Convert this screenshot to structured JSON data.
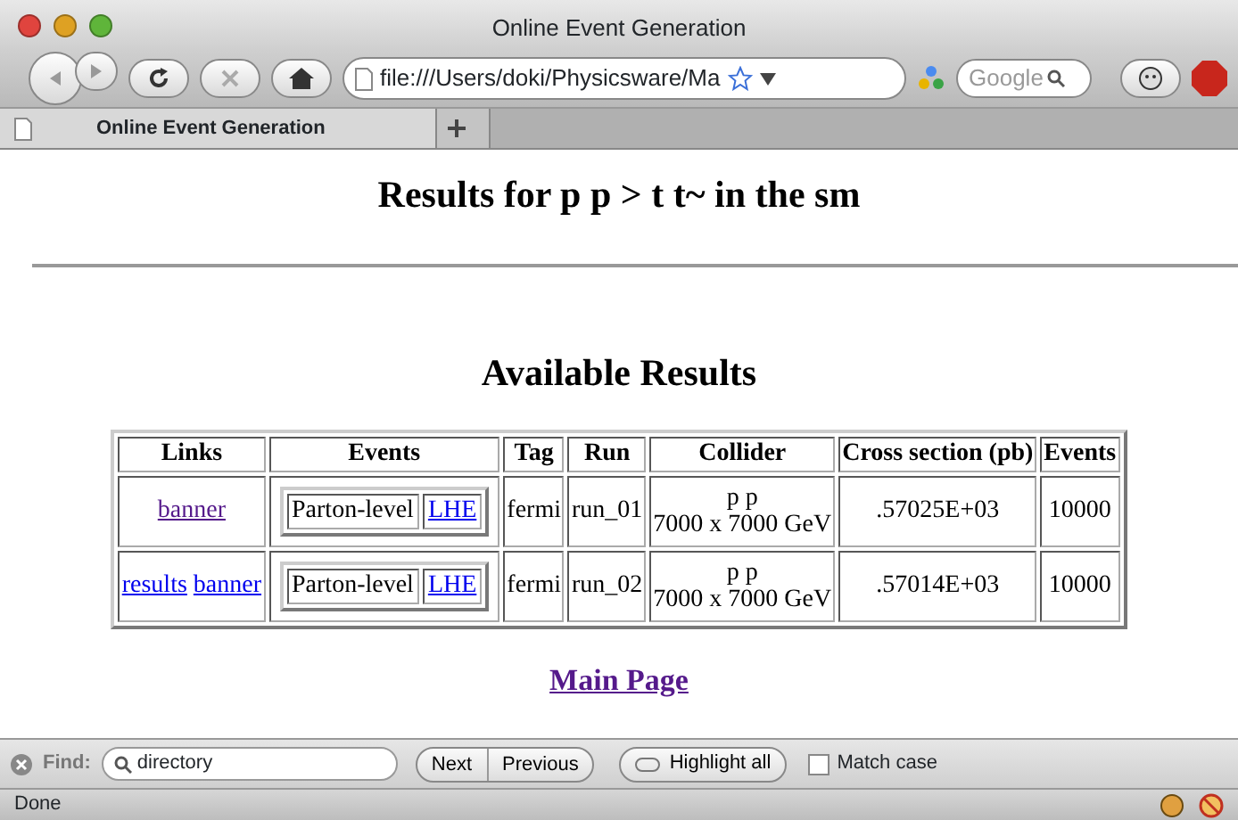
{
  "window": {
    "title": "Online Event Generation"
  },
  "toolbar": {
    "url": "file:///Users/doki/Physicsware/Ma",
    "search_placeholder": "Google"
  },
  "tabs": [
    {
      "label": "Online Event Generation",
      "selected": true
    }
  ],
  "page": {
    "heading": "Results for p p > t t~ in the sm",
    "subheading": "Available Results",
    "table": {
      "columns": [
        "Links",
        "Events",
        "Tag",
        "Run",
        "Collider",
        "Cross section (pb)",
        "Events"
      ],
      "rows": [
        {
          "links": [
            {
              "text": "banner",
              "visited": true
            }
          ],
          "events": {
            "label": "Parton-level",
            "link": {
              "text": "LHE",
              "visited": false
            }
          },
          "tag": "fermi",
          "run": "run_01",
          "collider": [
            "p p",
            "7000 x 7000 GeV"
          ],
          "cross_section": ".57025E+03",
          "n_events": "10000"
        },
        {
          "links": [
            {
              "text": "results",
              "visited": false
            },
            {
              "text": "banner",
              "visited": false
            }
          ],
          "events": {
            "label": "Parton-level",
            "link": {
              "text": "LHE",
              "visited": false
            }
          },
          "tag": "fermi",
          "run": "run_02",
          "collider": [
            "p p",
            "7000 x 7000 GeV"
          ],
          "cross_section": ".57014E+03",
          "n_events": "10000"
        }
      ]
    },
    "main_link": {
      "text": "Main Page",
      "visited": true
    }
  },
  "find_bar": {
    "label": "Find:",
    "value": "directory",
    "buttons": [
      "Next",
      "Previous"
    ],
    "highlight_label": "Highlight all",
    "match_case": {
      "label": "Match case",
      "checked": false
    }
  },
  "status_bar": {
    "text": "Done"
  }
}
